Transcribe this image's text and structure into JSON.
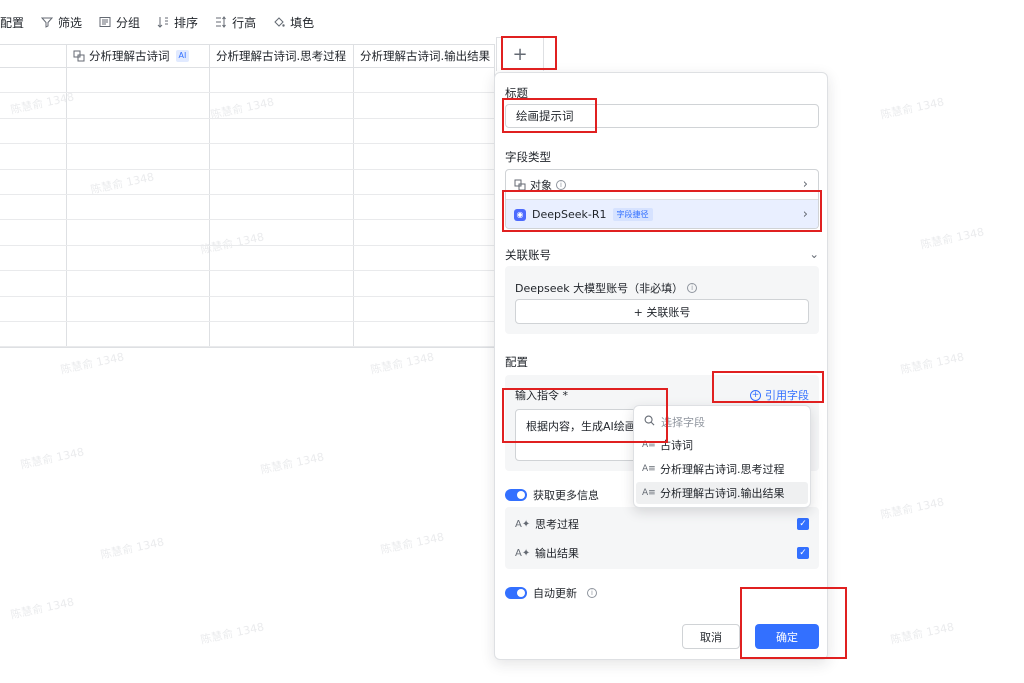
{
  "toolbar": {
    "items": [
      {
        "label": "配置",
        "icon": "field-config-icon"
      },
      {
        "label": "筛选",
        "icon": "filter-icon"
      },
      {
        "label": "分组",
        "icon": "group-icon"
      },
      {
        "label": "排序",
        "icon": "sort-icon"
      },
      {
        "label": "行高",
        "icon": "row-height-icon"
      },
      {
        "label": "填色",
        "icon": "fill-color-icon"
      }
    ]
  },
  "grid": {
    "columns": [
      {
        "label": ""
      },
      {
        "label": "分析理解古诗词",
        "tag": "AI"
      },
      {
        "label": "分析理解古诗词.思考过程"
      },
      {
        "label": "分析理解古诗词.输出结果"
      }
    ],
    "add_column_label": "+"
  },
  "panel": {
    "title_label": "标题",
    "title_value": "绘画提示词",
    "field_type_label": "字段类型",
    "type_object": "对象",
    "type_selected": "DeepSeek-R1",
    "type_selected_tag": "字段捷径",
    "account_label": "关联账号",
    "account_field_label": "Deepseek 大模型账号（非必填）",
    "account_button": "+ 关联账号",
    "config_label": "配置",
    "prompt_label": "输入指令 *",
    "reference_field": "引用字段",
    "prompt_value": "根据内容，生成AI绘画",
    "more_info_label": "获取更多信息",
    "more_info_items": [
      "思考过程",
      "输出结果"
    ],
    "auto_update_label": "自动更新",
    "cancel_button": "取消",
    "ok_button": "确定"
  },
  "dropdown": {
    "search_placeholder": "选择字段",
    "items": [
      "古诗词",
      "分析理解古诗词.思考过程",
      "分析理解古诗词.输出结果"
    ]
  },
  "watermark": "陈慧俞 1348",
  "colors": {
    "accent": "#3370ff",
    "annotation": "#e02020"
  }
}
